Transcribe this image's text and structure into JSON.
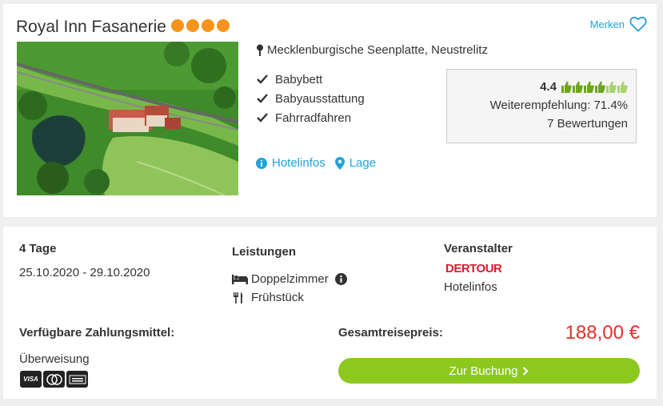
{
  "hotel": {
    "name": "Royal Inn Fasanerie",
    "stars": 4,
    "location": "Mecklenburgische Seenplatte, Neustrelitz",
    "features": [
      "Babybett",
      "Babyausstattung",
      "Fahrradfahren"
    ],
    "links": {
      "hotelinfos": "Hotelinfos",
      "lage": "Lage"
    },
    "merken": "Merken",
    "image_icon": "hotel-aerial-photo"
  },
  "rating": {
    "value": "4.4",
    "thumbs_value": 4.4,
    "thumbs_max": 6,
    "recommendation": "Weiterempfehlung: 71.4%",
    "reviews": "7 Bewertungen"
  },
  "offer": {
    "duration": "4 Tage",
    "dates": "25.10.2020 - 29.10.2020",
    "services_label": "Leistungen",
    "services": [
      {
        "label": "Doppelzimmer",
        "icon": "bed-icon"
      },
      {
        "label": "Frühstück",
        "icon": "cutlery-icon"
      }
    ],
    "organizer_label": "Veranstalter",
    "organizer_logo": "DERTOUR",
    "organizer_link": "Hotelinfos",
    "payment_label": "Verfügbare Zahlungsmittel:",
    "payment_method": "Überweisung",
    "payment_cards": [
      "VISA",
      "Mastercard",
      "American Express"
    ],
    "total_label": "Gesamtreisepreis:",
    "price": "188,00 €",
    "book_button": "Zur Buchung"
  },
  "colors": {
    "accent": "#1fa3d9",
    "star": "#f7941d",
    "price": "#e0302a",
    "button": "#8cc81e",
    "thumb": "#6ea51b"
  }
}
